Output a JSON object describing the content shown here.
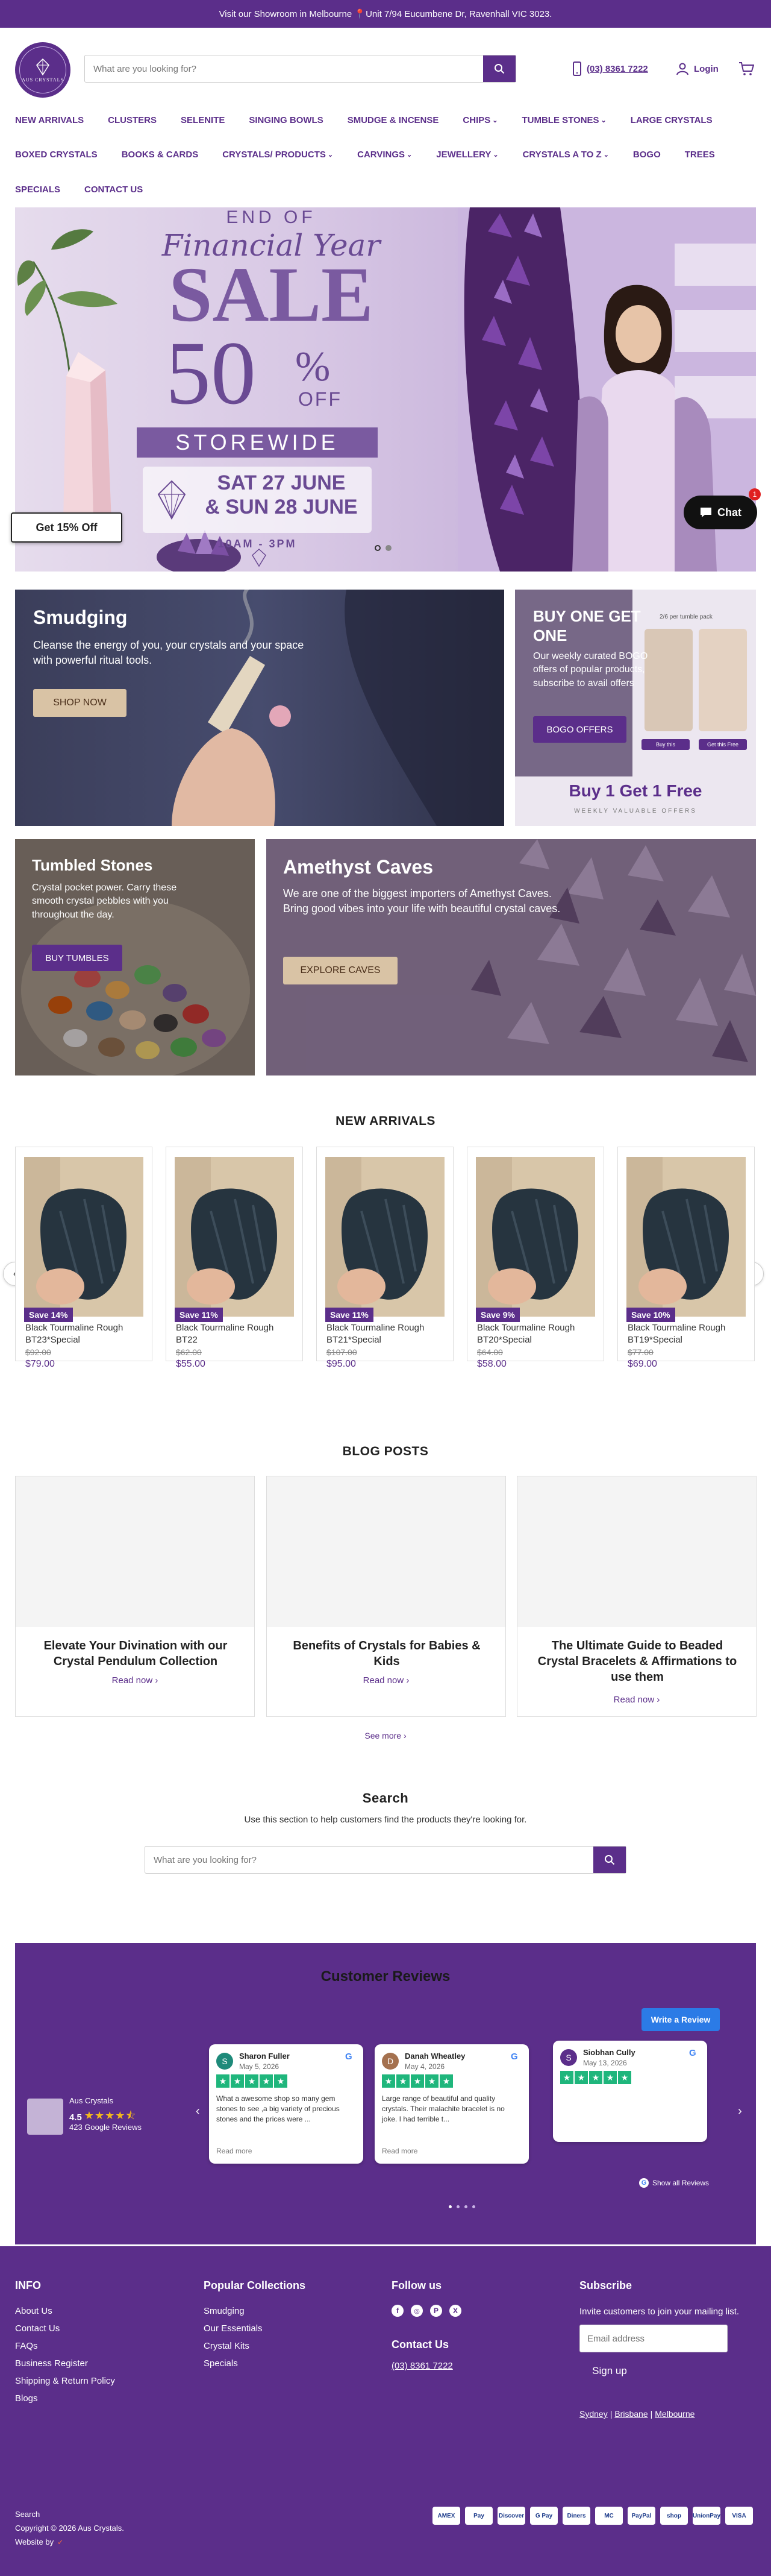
{
  "announcement": {
    "text": "Visit our Showroom in Melbourne 📍Unit 7/94 Eucumbene Dr, Ravenhall VIC 3023."
  },
  "header": {
    "logo_text": "AUS CRYSTALS",
    "search_placeholder": "What are you looking for?",
    "phone": "(03) 8361 7222",
    "login_label": "Login",
    "nav_row1": [
      {
        "label": "NEW ARRIVALS",
        "dropdown": false
      },
      {
        "label": "CLUSTERS",
        "dropdown": false
      },
      {
        "label": "SELENITE",
        "dropdown": false
      },
      {
        "label": "SINGING BOWLS",
        "dropdown": false
      },
      {
        "label": "SMUDGE & INCENSE",
        "dropdown": false
      },
      {
        "label": "CHIPS",
        "dropdown": true
      },
      {
        "label": "TUMBLE STONES",
        "dropdown": true
      },
      {
        "label": "LARGE CRYSTALS",
        "dropdown": false
      }
    ],
    "nav_row2": [
      {
        "label": "BOXED CRYSTALS",
        "dropdown": false
      },
      {
        "label": "BOOKS & CARDS",
        "dropdown": false
      },
      {
        "label": "CRYSTALS/ PRODUCTS",
        "dropdown": true
      },
      {
        "label": "CARVINGS",
        "dropdown": true
      },
      {
        "label": "JEWELLERY",
        "dropdown": true
      },
      {
        "label": "CRYSTALS A TO Z",
        "dropdown": true
      },
      {
        "label": "BOGO",
        "dropdown": false
      },
      {
        "label": "TREES",
        "dropdown": false
      }
    ],
    "nav_row3": [
      {
        "label": "SPECIALS",
        "dropdown": false
      },
      {
        "label": "CONTACT US",
        "dropdown": false
      }
    ]
  },
  "hero": {
    "line1": "END OF",
    "line2": "Financial Year",
    "line3": "SALE",
    "percent": "50",
    "percent_sign": "%",
    "off": "OFF",
    "storewide": "STOREWIDE",
    "date1": "SAT 27 JUNE",
    "date2": "& SUN 28 JUNE",
    "time": "10AM - 3PM"
  },
  "popup_button": "Get 15% Off",
  "chat": {
    "label": "Chat",
    "badge": "1"
  },
  "promos": {
    "smudging": {
      "title": "Smudging",
      "text": "Cleanse the energy of you, your crystals and your space with powerful ritual tools.",
      "button": "SHOP NOW"
    },
    "bogo": {
      "title": "BUY ONE GET ONE",
      "text": "Our weekly curated BOGO offers of popular products, subscribe to avail offers",
      "button": "BOGO OFFERS",
      "poster_caption": "2/6 per tumble pack",
      "poster_label_buy": "Buy this",
      "poster_label_get": "Get this Free",
      "poster_big": "Buy 1 Get 1 Free",
      "poster_small": "WEEKLY VALUABLE OFFERS"
    },
    "tumbled": {
      "title": "Tumbled Stones",
      "text": "Crystal pocket power. Carry these smooth crystal pebbles with you throughout the day.",
      "button": "BUY TUMBLES"
    },
    "amethyst": {
      "title": "Amethyst Caves",
      "text": "We are one of the biggest importers of Amethyst Caves. Bring good vibes into your life with beautiful crystal caves.",
      "button": "EXPLORE CAVES"
    }
  },
  "new_arrivals": {
    "title": "NEW ARRIVALS",
    "products": [
      {
        "badge": "Save 14%",
        "title": "Black Tourmaline Rough BT23*Special",
        "old_price": "$92.00",
        "price": "$79.00"
      },
      {
        "badge": "Save 11%",
        "title": "Black Tourmaline Rough BT22",
        "old_price": "$62.00",
        "price": "$55.00"
      },
      {
        "badge": "Save 11%",
        "title": "Black Tourmaline Rough BT21*Special",
        "old_price": "$107.00",
        "price": "$95.00"
      },
      {
        "badge": "Save 9%",
        "title": "Black Tourmaline Rough BT20*Special",
        "old_price": "$64.00",
        "price": "$58.00"
      },
      {
        "badge": "Save 10%",
        "title": "Black Tourmaline Rough BT19*Special",
        "old_price": "$77.00",
        "price": "$69.00"
      }
    ]
  },
  "blog": {
    "title": "BLOG POSTS",
    "posts": [
      {
        "title": "Elevate Your Divination with our Crystal Pendulum Collection",
        "read": "Read now"
      },
      {
        "title": "Benefits of Crystals for Babies & Kids",
        "read": "Read now"
      },
      {
        "title": "The Ultimate Guide to Beaded Crystal Bracelets & Affirmations to use them",
        "read": "Read now"
      }
    ],
    "see_more": "See more"
  },
  "search_section": {
    "title": "Search",
    "subtitle": "Use this section to help customers find the products they're looking for.",
    "placeholder": "What are you looking for?"
  },
  "reviews": {
    "title": "Customer Reviews",
    "write_button": "Write a Review",
    "business_name": "Aus Crystals",
    "rating": "4.5",
    "count": "423 Google Reviews",
    "show_all": "Show all Reviews",
    "items": [
      {
        "initial": "S",
        "name": "Sharon Fuller",
        "date": "May 5, 2026",
        "text": "What a awesome shop so many gem stones to see ,a big variety of precious stones and the prices were ...",
        "more": "Read more",
        "avatar_color": "#1e8a7a"
      },
      {
        "initial": "D",
        "name": "Danah Wheatley",
        "date": "May 4, 2026",
        "text": "Large range of beautiful and quality crystals. Their malachite bracelet is no joke. I had terrible t...",
        "more": "Read more",
        "avatar_color": "#a4714f"
      },
      {
        "initial": "S",
        "name": "Siobhan Cully",
        "date": "May 13, 2026",
        "text": "",
        "more": "",
        "avatar_color": "#5b2e8a"
      }
    ]
  },
  "footer": {
    "info_title": "INFO",
    "info_links": [
      "About Us",
      "Contact Us",
      "FAQs",
      "Business Register",
      "Shipping & Return Policy",
      "Blogs"
    ],
    "popular_title": "Popular Collections",
    "popular_links": [
      "Smudging",
      "Our Essentials",
      "Crystal Kits",
      "Specials"
    ],
    "follow_title": "Follow us",
    "contact_title": "Contact Us",
    "contact_phone": "(03) 8361 7222",
    "subscribe_title": "Subscribe",
    "subscribe_text": "Invite customers to join your mailing list.",
    "email_placeholder": "Email address",
    "signup": "Sign up",
    "cities": [
      "Sydney",
      "Brisbane",
      "Melbourne"
    ],
    "bottom_search": "Search",
    "copyright": "Copyright © 2026 Aus Crystals.",
    "website_by": "Website by",
    "payments": [
      "AMEX",
      "Pay",
      "Discover",
      "G Pay",
      "Diners",
      "MC",
      "PayPal",
      "shop",
      "UnionPay",
      "VISA"
    ]
  },
  "colors": {
    "brand": "#5b2e8a",
    "badge": "#5b2e8a",
    "button_tan": "#d9c3a5"
  }
}
